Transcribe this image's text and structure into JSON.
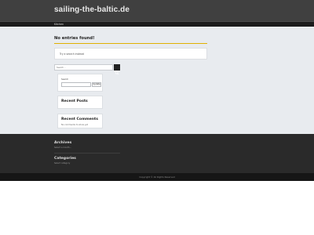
{
  "header": {
    "site_title": "sailing-the-baltic.de"
  },
  "nav": {
    "items": [
      {
        "label": "Kitchen"
      }
    ]
  },
  "main": {
    "heading": "No entries found!",
    "notice": "Try a search instead",
    "search": {
      "placeholder": "Search ..."
    }
  },
  "sidebar": {
    "calendar": {
      "label": "Search",
      "button": "Update"
    },
    "recent_posts": {
      "title": "Recent Posts"
    },
    "recent_comments": {
      "title": "Recent Comments",
      "text": "No comments to show yet"
    }
  },
  "footer": {
    "archives": {
      "title": "Archives",
      "text": "Select a month..."
    },
    "categories": {
      "title": "Categories",
      "text": "Select category"
    },
    "copyright": "Copyright © All Rights Reserved"
  },
  "colors": {
    "header_bg": "#404040",
    "nav_bg": "#1c1c1c",
    "content_bg": "#e8ebef",
    "accent": "#e0b000",
    "footer_bg": "#2a2a2a",
    "footer_bottom_bg": "#161616"
  }
}
